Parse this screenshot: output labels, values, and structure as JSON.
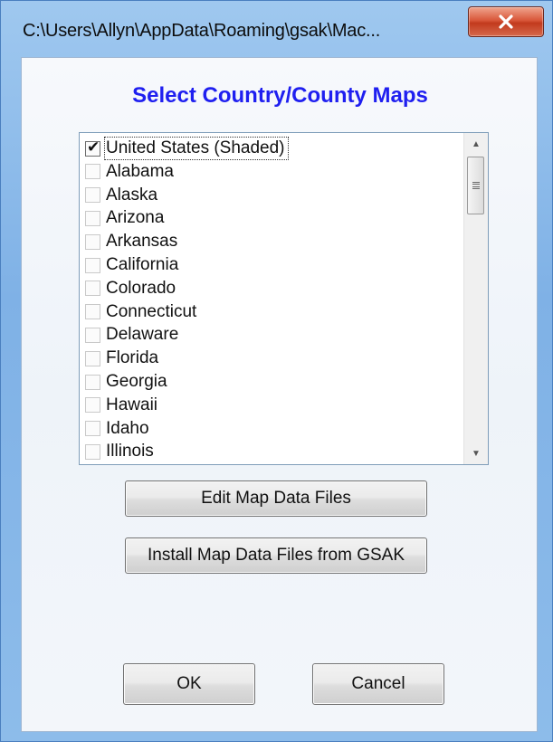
{
  "window": {
    "title": "C:\\Users\\Allyn\\AppData\\Roaming\\gsak\\Mac...",
    "close_icon": "close-icon"
  },
  "dialog": {
    "heading": "Select Country/County Maps",
    "heading_color": "#1f1ff0",
    "list": {
      "items": [
        {
          "label": "United States (Shaded)",
          "checked": true,
          "focused": true
        },
        {
          "label": "Alabama",
          "checked": false
        },
        {
          "label": "Alaska",
          "checked": false
        },
        {
          "label": "Arizona",
          "checked": false
        },
        {
          "label": "Arkansas",
          "checked": false
        },
        {
          "label": "California",
          "checked": false
        },
        {
          "label": "Colorado",
          "checked": false
        },
        {
          "label": "Connecticut",
          "checked": false
        },
        {
          "label": "Delaware",
          "checked": false
        },
        {
          "label": "Florida",
          "checked": false
        },
        {
          "label": "Georgia",
          "checked": false
        },
        {
          "label": "Hawaii",
          "checked": false
        },
        {
          "label": "Idaho",
          "checked": false
        },
        {
          "label": "Illinois",
          "checked": false
        }
      ]
    },
    "buttons": {
      "edit": "Edit Map Data Files",
      "install": "Install Map Data Files from GSAK",
      "ok": "OK",
      "cancel": "Cancel"
    }
  }
}
